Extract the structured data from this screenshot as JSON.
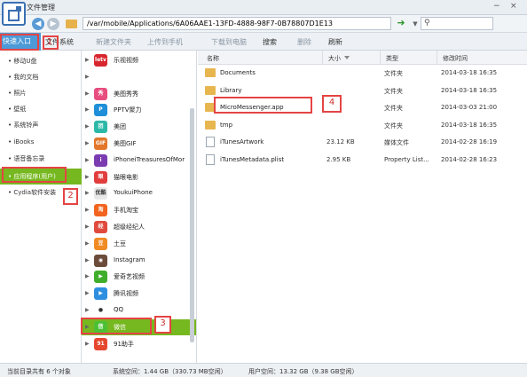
{
  "title": "文件管理",
  "path": "/var/mobile/Applications/6A06AAE1-13FD-4888-98F7-0B78807D1E13",
  "search_placeholder": "",
  "toolbar": {
    "quick_entry": "快速入口",
    "file_system": "文件系统",
    "new_folder": "新建文件夹",
    "upload": "上传到手机",
    "download": "下载到电脑",
    "search": "搜索",
    "delete": "删除",
    "refresh": "刷新"
  },
  "sidebar": [
    "移动U盘",
    "我的文档",
    "照片",
    "壁纸",
    "系统铃声",
    "iBooks",
    "语音备忘录",
    "应用程序(用户)",
    "Cydia软件安装"
  ],
  "sidebar_active": 7,
  "apps": [
    {
      "name": "乐视视频",
      "icon": "letv",
      "color": "#d8262f",
      "glyph": "letv"
    },
    {
      "name": "",
      "icon": "blank",
      "color": "#ffffff",
      "glyph": ""
    },
    {
      "name": "美图秀秀",
      "icon": "meitu-xiuxiu",
      "color": "#e84d7f",
      "glyph": "秀"
    },
    {
      "name": "PPTV聚力",
      "icon": "pptv",
      "color": "#1e8fd8",
      "glyph": "P"
    },
    {
      "name": "美团",
      "icon": "meituan",
      "color": "#2bb8a8",
      "glyph": "团"
    },
    {
      "name": "美图GIF",
      "icon": "meitu-gif",
      "color": "#e2772b",
      "glyph": "GIF"
    },
    {
      "name": "iPhoneiTreasuresOfMor",
      "icon": "treasures",
      "color": "#7a3cb0",
      "glyph": "i"
    },
    {
      "name": "猫眼电影",
      "icon": "maoyan",
      "color": "#e13d3d",
      "glyph": "眼"
    },
    {
      "name": "YoukuiPhone",
      "icon": "youku",
      "color": "#e8e8e8",
      "glyph": "优酷"
    },
    {
      "name": "手机淘宝",
      "icon": "taobao",
      "color": "#f2641f",
      "glyph": "淘"
    },
    {
      "name": "超级经纪人",
      "icon": "agent",
      "color": "#e04a3d",
      "glyph": "经"
    },
    {
      "name": "土豆",
      "icon": "tudou",
      "color": "#f08a24",
      "glyph": "豆"
    },
    {
      "name": "Instagram",
      "icon": "instagram",
      "color": "#6b4b3a",
      "glyph": "◉"
    },
    {
      "name": "爱奇艺视频",
      "icon": "iqiyi",
      "color": "#3fae2a",
      "glyph": "▶"
    },
    {
      "name": "腾讯视频",
      "icon": "tencent-video",
      "color": "#2e8fe0",
      "glyph": "▶"
    },
    {
      "name": "QQ",
      "icon": "qq",
      "color": "#ffffff",
      "glyph": "●"
    },
    {
      "name": "微信",
      "icon": "wechat",
      "color": "#4cc035",
      "glyph": "信"
    },
    {
      "name": "91助手",
      "icon": "91-assistant",
      "color": "#e5472f",
      "glyph": "91"
    }
  ],
  "apps_active": 16,
  "file_columns": [
    "名称",
    "大小",
    "类型",
    "修改时间"
  ],
  "files": [
    {
      "name": "Documents",
      "size": "",
      "kind": "文件夹",
      "date": "2014-03-18 16:35",
      "icon": "folder"
    },
    {
      "name": "Library",
      "size": "",
      "kind": "文件夹",
      "date": "2014-03-18 16:35",
      "icon": "folder"
    },
    {
      "name": "MicroMessenger.app",
      "size": "",
      "kind": "文件夹",
      "date": "2014-03-03 21:00",
      "icon": "folder"
    },
    {
      "name": "tmp",
      "size": "",
      "kind": "文件夹",
      "date": "2014-03-18 16:35",
      "icon": "folder"
    },
    {
      "name": "iTunesArtwork",
      "size": "23.12 KB",
      "kind": "媒体文件",
      "date": "2014-02-28 16:19",
      "icon": "media-file"
    },
    {
      "name": "iTunesMetadata.plist",
      "size": "2.95 KB",
      "kind": "Property List...",
      "date": "2014-02-28 16:23",
      "icon": "plist-file"
    }
  ],
  "status": {
    "count": "当前目录共有 6 个对象",
    "system_space": "系统空间：1.44 GB（330.73 MB空闲）",
    "system_used_fraction": 0.78,
    "user_space": "用户空间：13.32 GB（9.38 GB空闲）",
    "user_used_fraction": 0.3
  },
  "steps": [
    "1",
    "2",
    "3",
    "4"
  ],
  "colors": {
    "accent": "#4d9ad8",
    "active": "#76b81f",
    "highlight": "#e54444"
  }
}
